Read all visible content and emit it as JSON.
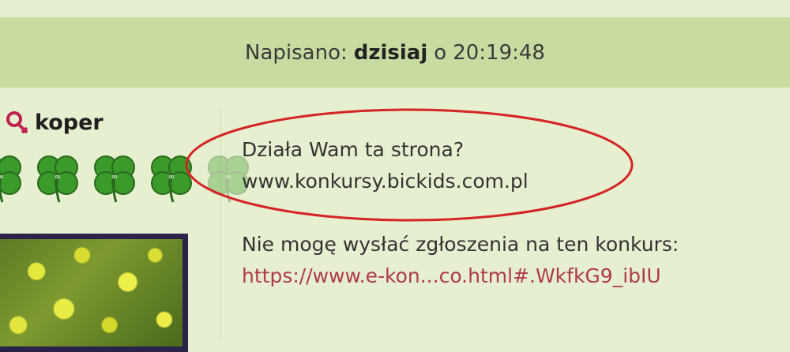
{
  "post_header": {
    "prefix": "Napisano:",
    "day": "dzisiaj",
    "connector": "o",
    "time": "20:19:48"
  },
  "author": {
    "name": "koper",
    "gender_icon": "female-symbol-icon",
    "rank_icons": [
      "clover-icon",
      "clover-icon",
      "clover-icon",
      "clover-icon",
      "clover-icon-faded"
    ]
  },
  "message": {
    "line1": "Działa Wam ta strona?",
    "line2": "www.konkursy.bickids.com.pl",
    "line3": "Nie mogę wysłać zgłoszenia na ten konkurs:",
    "link": "https://www.e-kon...co.html#.WkfkG9_ibIU"
  },
  "colors": {
    "header_bg": "#c8dca2",
    "page_bg": "#e6efcf",
    "link": "#b03a4a",
    "annotation": "#d42424"
  }
}
